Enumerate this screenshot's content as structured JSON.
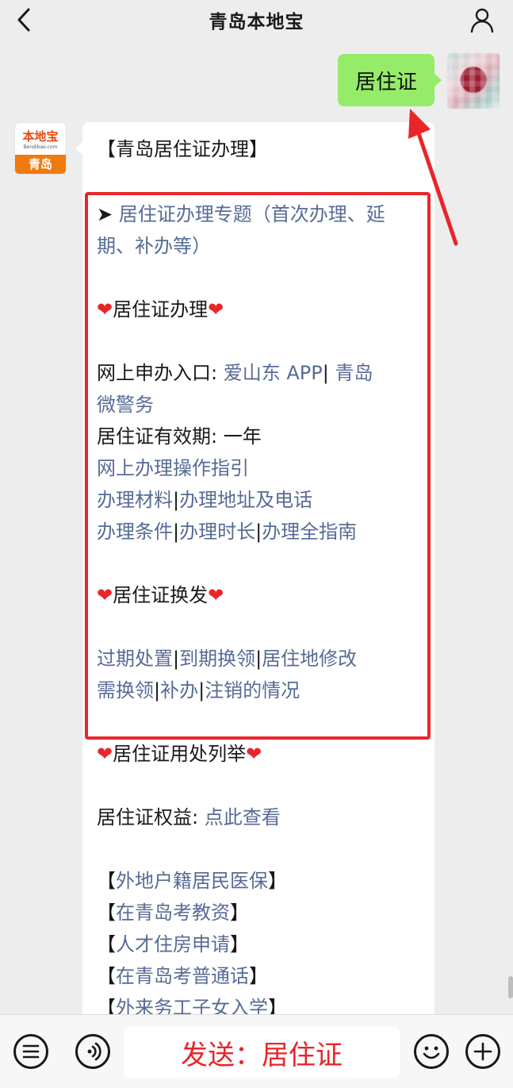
{
  "header": {
    "title": "青岛本地宝",
    "back_icon": "chevron-left-icon",
    "profile_icon": "person-icon"
  },
  "user_message": "居住证",
  "bot_avatar": {
    "brand": "本地宝",
    "sub": "Bendibao.com",
    "city": "青岛"
  },
  "reply": {
    "title": "【青岛居住证办理】",
    "topic_arrow": "➤ ",
    "topic_link_line1": "居住证办理专题（首次办理、延",
    "topic_link_line2": "期、补办等）",
    "section1_heading": "居住证办理",
    "online_entry_label": "网上申办入口: ",
    "online_entry_link1": "爱山东 APP",
    "online_entry_sep": "|",
    "online_entry_link2a": " 青岛",
    "online_entry_link2b": "微警务",
    "validity": "居住证有效期: 一年",
    "guide_link": "网上办理操作指引",
    "materials_link": "办理材料",
    "address_link": "办理地址及电话",
    "conditions_link": "办理条件",
    "duration_link": "办理时长",
    "full_guide_link": "办理全指南",
    "section2_heading": "居住证换发",
    "expired_link": "过期处置",
    "renew_link": "到期换领",
    "address_change_link_a": "居住地修改",
    "address_change_link_b": "需换领",
    "reissue_link": "补办",
    "cancel_link": "注销的情况",
    "section3_heading": "居住证用处列举",
    "rights_label": "居住证权益: ",
    "rights_link": "点此查看",
    "bottom_links": [
      {
        "lb": "【",
        "text": "外地户籍居民医保",
        "rb": "】"
      },
      {
        "lb": "【",
        "text": "在青岛考教资",
        "rb": "】"
      },
      {
        "lb": "【",
        "text": "人才住房申请",
        "rb": "】"
      },
      {
        "lb": "【",
        "text": "在青岛考普通话",
        "rb": "】"
      },
      {
        "lb": "【",
        "text": "外来务工子女入学",
        "rb": "】"
      }
    ],
    "separator": "|"
  },
  "input": {
    "text": "发送：居住证"
  },
  "colors": {
    "accent_red": "#e8262a",
    "link_blue": "#576b95",
    "bubble_green": "#95ec69"
  }
}
